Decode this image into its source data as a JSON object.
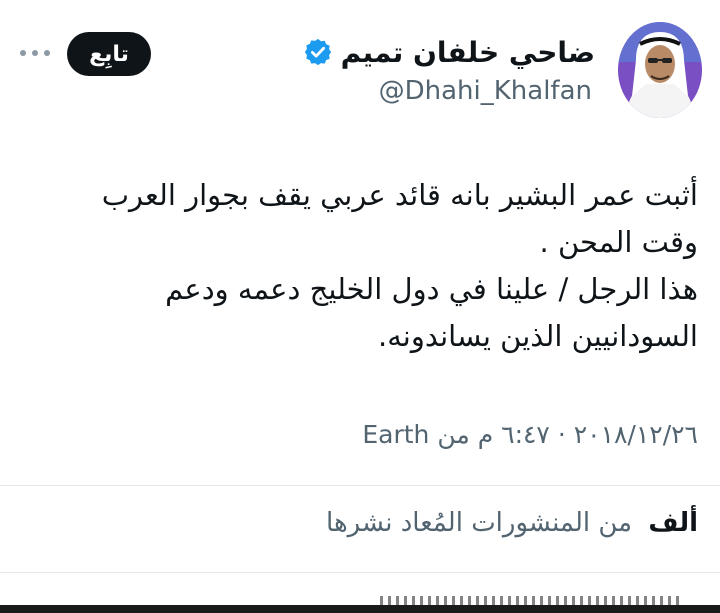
{
  "tweet": {
    "author": {
      "display_name": "ضاحي خلفان تميم",
      "handle": "@Dhahi_Khalfan",
      "verified": true,
      "verified_color": "#1d9bf0"
    },
    "follow_label": "تابِع",
    "more_icon": "more-horizontal-icon",
    "lines": [
      "أثبت عمر البشير بانه قائد عربي يقف بجوار العرب",
      "وقت المحن .",
      "هذا الرجل / علينا في دول الخليج دعمه ودعم",
      "السودانيين الذين يساندونه."
    ],
    "date": "٢٠١٨/١٢/٢٦",
    "separator": "·",
    "time": "٦:٤٧ م",
    "source_prefix": "من",
    "source": "Earth",
    "retweets": {
      "count": "ألف",
      "label": "من المنشورات المُعاد نشرها"
    }
  }
}
